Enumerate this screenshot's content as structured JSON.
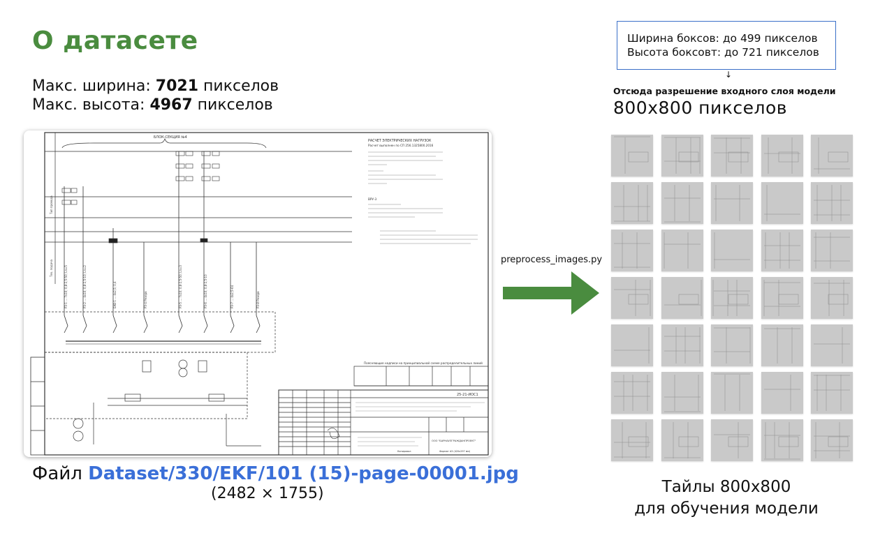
{
  "title": "О датасете",
  "stats": {
    "width_prefix": "Макс. ширина: ",
    "width_value": "7021",
    "width_suffix": " пикселов",
    "height_prefix": "Макс. высота: ",
    "height_value": "4967",
    "height_suffix": " пикселов"
  },
  "file": {
    "prefix": "Файл ",
    "path": "Dataset/330/EKF/101 (15)-page-00001.jpg",
    "dims": "(2482 × 1755)"
  },
  "box_info": {
    "line1": "Ширина боксов: до 499 пикселов",
    "line2": "Высота боксовт: до 721 пикселов"
  },
  "small_arrow": "↓",
  "resolution": {
    "label": "Отсюда разрешение входного слоя модели",
    "value": "800x800 пикселов"
  },
  "script": "preprocess_images.py",
  "arrow_color": "#4a8c3f",
  "tiles_caption": {
    "line1": "Тайлы 800x800",
    "line2": "для обучения модели"
  },
  "document": {
    "block_title": "БЛОК-СЕКЦИЯ №4",
    "calc_title": "РАСЧЕТ ЭЛЕКТРИЧЕСКИХ НАГРУЗОК",
    "calc_subtitle": "Расчет выполнен по СП 256.1325800.2016",
    "vru_label": "ВРУ-3",
    "legend_title": "Поясняющие надписи на принципиальной схеме распределительных линий",
    "stamp_code": "25-21-ИОС1",
    "stamp_org": "ООО \"БАРНАУЛГРАЖДАНПРОЕКТ\"",
    "stamp_format": "Формат А3 (420х297 мм)",
    "stamp_copied": "Копировал"
  }
}
